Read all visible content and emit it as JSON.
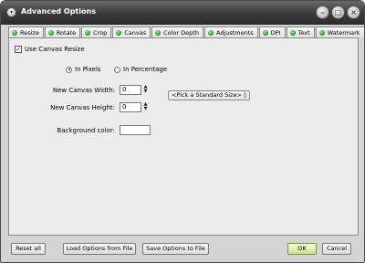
{
  "window": {
    "title": "Advanced Options",
    "menu_glyph": "▾",
    "min_glyph": "–",
    "max_glyph": "□",
    "close_glyph": "×"
  },
  "tabs": [
    {
      "label": "Resize"
    },
    {
      "label": "Rotate"
    },
    {
      "label": "Crop"
    },
    {
      "label": "Canvas",
      "active": true
    },
    {
      "label": "Color Depth"
    },
    {
      "label": "Adjustments"
    },
    {
      "label": "DPI"
    },
    {
      "label": "Text"
    },
    {
      "label": "Watermark"
    }
  ],
  "canvas": {
    "use_resize_label": "Use Canvas Resize",
    "use_resize_checked": "✓",
    "radio_pixels": "In Pixels",
    "radio_percentage": "In Percentage",
    "width_label": "New Canvas Width:",
    "width_value": "0",
    "height_label": "New Canvas Height:",
    "height_value": "0",
    "spin_up": "▲",
    "spin_down": "▼",
    "standard_size": "<Pick a Standard Size> ◊",
    "bg_label": "Background color:"
  },
  "footer": {
    "reset": "Reset all",
    "load": "Load Options from File",
    "save": "Save Options to File",
    "ok": "OK",
    "cancel": "Cancel"
  },
  "colors": {
    "titlebar": "#3a3a3a",
    "tab_dot": "#1fa51f",
    "ok_button": "#c9e48a"
  }
}
